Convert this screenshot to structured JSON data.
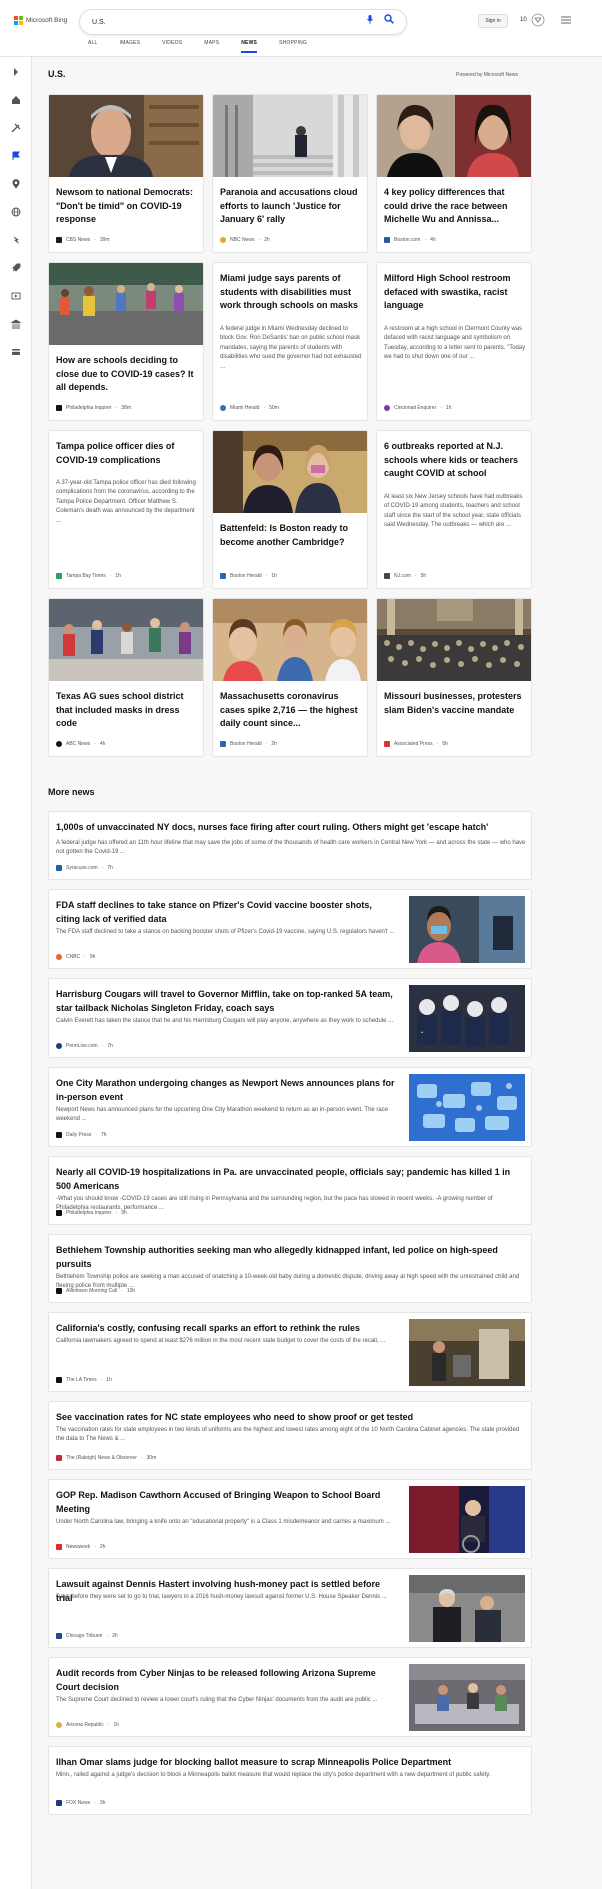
{
  "header": {
    "logo": "Microsoft Bing",
    "search_value": "U.S.",
    "signin_label": "Sign in",
    "points": "10",
    "tabs": [
      "ALL",
      "IMAGES",
      "VIDEOS",
      "MAPS",
      "NEWS",
      "SHOPPING"
    ],
    "active_tab": "NEWS"
  },
  "colors": {
    "accent": "#174ae4",
    "background": "#f7f7f7"
  },
  "sidebar": {
    "icons": [
      "chevron-right-icon",
      "home-icon",
      "tools-icon",
      "flag-icon",
      "location-pin-icon",
      "globe-icon",
      "bolt-icon",
      "rocket-icon",
      "film-icon",
      "bank-icon",
      "card-icon"
    ]
  },
  "section": {
    "title": "U.S.",
    "powered_by": "Powered by Microsoft News"
  },
  "cards": [
    {
      "title": "Newsom to national Democrats: \"Don't be timid\" on COVID-19 response",
      "summary": "",
      "source": "CBS News",
      "time": "39m"
    },
    {
      "title": "Paranoia and accusations cloud efforts to launch 'Justice for January 6' rally",
      "summary": "",
      "source": "NBC News",
      "time": "2h"
    },
    {
      "title": "4 key policy differences that could drive the race between Michelle Wu and Annissa...",
      "summary": "",
      "source": "Boston.com",
      "time": "4h"
    },
    {
      "title": "How are schools deciding to close due to COVID-19 cases? It all depends.",
      "summary": "",
      "source": "Philadelphia Inquirer",
      "time": "38m"
    },
    {
      "title": "Miami judge says parents of students with disabilities must work through schools on masks",
      "summary": "A federal judge in Miami Wednesday declined to block Gov. Ron DeSantis' ban on public school mask mandates, saying the parents of students with disabilities who sued the governor had not exhausted ...",
      "source": "Miami Herald",
      "time": "50m"
    },
    {
      "title": "Milford High School restroom defaced with swastika, racist language",
      "summary": "A restroom at a high school in Clermont County was defaced with racist language and symbolism on Tuesday, according to a letter sent to parents. \"Today we had to shut down one of our ...",
      "source": "Cincinnati Enquirer",
      "time": "1h"
    },
    {
      "title": "Tampa police officer dies of COVID-19 complications",
      "summary": "A 37-year-old Tampa police officer has died following complications from the coronavirus, according to the Tampa Police Department. Officer Matthew S. Coleman's death was announced by the department ...",
      "source": "Tampa Bay Times",
      "time": "1h"
    },
    {
      "title": "Battenfeld: Is Boston ready to become another Cambridge?",
      "summary": "",
      "source": "Boston Herald",
      "time": "1h"
    },
    {
      "title": "6 outbreaks reported at N.J. schools where kids or teachers caught COVID at school",
      "summary": "At least six New Jersey schools have had outbreaks of COVID-19 among students, teachers and school staff since the start of the school year, state officials said Wednesday. The outbreaks — which are ...",
      "source": "NJ.com",
      "time": "5h"
    },
    {
      "title": "Texas AG sues school district that included masks in dress code",
      "summary": "",
      "source": "ABC News",
      "time": "4h"
    },
    {
      "title": "Massachusetts coronavirus cases spike 2,716 — the highest daily count since...",
      "summary": "",
      "source": "Boston Herald",
      "time": "2h"
    },
    {
      "title": "Missouri businesses, protesters slam Biden's vaccine mandate",
      "summary": "",
      "source": "Associated Press",
      "time": "5h"
    }
  ],
  "more_news": {
    "title": "More news",
    "items": [
      {
        "title": "1,000s of unvaccinated NY docs, nurses face firing after court ruling. Others might get 'escape hatch'",
        "summary": "A federal judge has offered an 11th hour lifeline that may save the jobs of some of the thousands of health care workers in Central New York — and across the state — who have not gotten the Covid-19 ...",
        "source": "Syracuse.com",
        "time": "7h"
      },
      {
        "title": "FDA staff declines to take stance on Pfizer's Covid vaccine booster shots, citing lack of verified data",
        "summary": "The FDA staff declined to take a stance on backing booster shots of Pfizer's Covid-19 vaccine, saying U.S. regulators haven't ...",
        "source": "CNBC",
        "time": "9h"
      },
      {
        "title": "Harrisburg Cougars will travel to Governor Mifflin, take on top-ranked 5A team, star tailback Nicholas Singleton Friday, coach says",
        "summary": "Calvin Everett has taken the stance that he and his Harrisburg Cougars will play anyone, anywhere as they work to schedule ...",
        "source": "PennLive.com",
        "time": "7h"
      },
      {
        "title": "One City Marathon undergoing changes as Newport News announces plans for in-person event",
        "summary": "Newport News has announced plans for the upcoming One City Marathon weekend to return as an in-person event. The race weekend ...",
        "source": "Daily Press",
        "time": "7h"
      },
      {
        "title": "Nearly all COVID-19 hospitalizations in Pa. are unvaccinated people, officials say; pandemic has killed 1 in 500 Americans",
        "summary": "-What you should know -COVID-19 cases are still rising in Pennsylvania and the surrounding region, but the pace has slowed in recent weeks. -A growing number of Philadelphia restaurants, performance ...",
        "source": "Philadelphia Inquirer",
        "time": "9h"
      },
      {
        "title": "Bethlehem Township authorities seeking man who allegedly kidnapped infant, led police on high-speed pursuits",
        "summary": "Bethlehem Township police are seeking a man accused of snatching a 10-week-old baby during a domestic dispute, driving away at high speed with the unrestrained child and fleeing police from multiple ...",
        "source": "Allentown Morning Call",
        "time": "10h"
      },
      {
        "title": "California's costly, confusing recall sparks an effort to rethink the rules",
        "summary": "California lawmakers agreed to spend at least $276 million in the most recent state budget to cover the costs of the recall, ...",
        "source": "The LA Times",
        "time": "1h"
      },
      {
        "title": "See vaccination rates for NC state employees who need to show proof or get tested",
        "summary": "The vaccination rates for state employees in two kinds of uniforms are the highest and lowest rates among eight of the 10 North Carolina Cabinet agencies. The state provided the data to The News & ...",
        "source": "The (Raleigh) News & Observer",
        "time": "30m"
      },
      {
        "title": "GOP Rep. Madison Cawthorn Accused of Bringing Weapon to School Board Meeting",
        "summary": "Under North Carolina law, bringing a knife onto an \"educational property\" is a Class 1 misdemeanor and carries a maximum ...",
        "source": "Newsweek",
        "time": "2h"
      },
      {
        "title": "Lawsuit against Dennis Hastert involving hush-money pact is settled before trial",
        "summary": "Days before they were set to go to trial, lawyers in a 2016 hush-money lawsuit against former U.S. House Speaker Dennis ...",
        "source": "Chicago Tribune",
        "time": "2h"
      },
      {
        "title": "Audit records from Cyber Ninjas to be released following Arizona Supreme Court decision",
        "summary": "The Supreme Court declined to review a lower court's ruling that the Cyber Ninjas' documents from the audit are public ...",
        "source": "Arizona Republic",
        "time": "1h"
      },
      {
        "title": "Ilhan Omar slams judge for blocking ballot measure to scrap Minneapolis Police Department",
        "summary": "Minn., railed against a judge's decision to block a Minneapolis ballot measure that would replace the city's police department with a new department of public safety.",
        "source": "FOX News",
        "time": "3h"
      }
    ]
  }
}
